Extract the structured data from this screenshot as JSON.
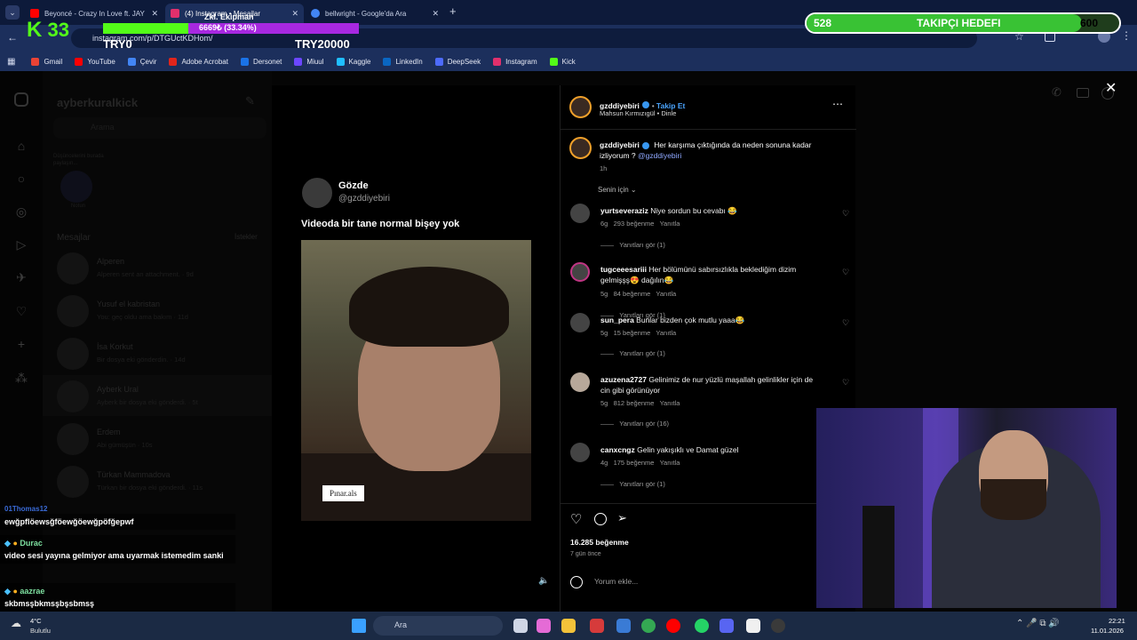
{
  "browser": {
    "tabs": [
      {
        "label": "Beyoncé - Crazy In Love ft. JAY",
        "color": "#ff0000"
      },
      {
        "label": "(4) Instagram • Mesajlar",
        "color": "#e1306c"
      },
      {
        "label": "bellwright - Google'da Ara",
        "color": "#4285f4"
      }
    ],
    "new_tab": "+",
    "url": "instagram.com/p/DTGUctKDHom/",
    "bookmarks": [
      {
        "label": "Gmail",
        "color": "#ea4335"
      },
      {
        "label": "YouTube",
        "color": "#ff0000"
      },
      {
        "label": "Çevir",
        "color": "#4285f4"
      },
      {
        "label": "Adobe Acrobat",
        "color": "#e1251b"
      },
      {
        "label": "Dersonet",
        "color": "#1a73e8"
      },
      {
        "label": "Miuul",
        "color": "#6c47ff"
      },
      {
        "label": "Kaggle",
        "color": "#20beff"
      },
      {
        "label": "LinkedIn",
        "color": "#0a66c2"
      },
      {
        "label": "DeepSeek",
        "color": "#4d6bfe"
      },
      {
        "label": "Instagram",
        "color": "#e1306c"
      },
      {
        "label": "Kick",
        "color": "#53fc18"
      }
    ]
  },
  "kick_overlay": {
    "logo": "33",
    "title": "Zkl. Ekipman",
    "progress_text": "6669₺ (33.34%)",
    "progress_fraction": 0.3334,
    "left_label": "TRY0",
    "right_label": "TRY20000"
  },
  "follower_goal": {
    "current": "528",
    "label": "TAKIPÇI HEDEFI",
    "target": "600",
    "fraction": 0.88
  },
  "sidebar": {
    "account": "ayberkuralkick",
    "search_placeholder": "Arama",
    "note_text": "Düşüncelerini burada paylaşın...",
    "note_name": "Notun",
    "section_title": "Mesajlar",
    "section_link": "İstekler",
    "conversations": [
      {
        "name": "Alperen",
        "snippet": "Alperen sent an attachment. · 9d"
      },
      {
        "name": "Yusuf el kabristan",
        "snippet": "You: geç oldu ama bakım · 11d"
      },
      {
        "name": "İsa Korkut",
        "snippet": "Bir dosya eki gönderdin. · 14d"
      },
      {
        "name": "Ayberk Ural",
        "snippet": "Ayberk bir dosya eki gönderdi. · 5t"
      },
      {
        "name": "Erdem",
        "snippet": "Abi gümüşün · 10s"
      },
      {
        "name": "Türkan Mammadova",
        "snippet": "Türkan bir dosya eki gönderdi. · 11s"
      }
    ]
  },
  "post": {
    "tweet_name": "Gözde",
    "tweet_handle": "@gzddiyebiri",
    "tweet_text": "Videoda bir tane normal bişey yok",
    "watermark": "Pınar.als",
    "author": "gzddiyebiri",
    "follow": "Takip Et",
    "music": "Mahsun Kırmızıgül • Dinle",
    "caption_user": "gzddiyebiri",
    "caption": "Her karşıma çıktığında da neden sonuna kadar izliyorum ?",
    "caption_mention": "@gzddiyebiri",
    "caption_time": "1h",
    "sort": "Senin için",
    "comments": [
      {
        "user": "yurtseveraziz",
        "text": "Niye sordun bu cevabı 😂",
        "meta": "6g   293 beğenme   Yanıtla",
        "replies": "Yanıtları gör (1)"
      },
      {
        "user": "tugceeesariii",
        "text": "Her bölümünü sabırsızlıkla beklediğim dizim gelmişşş😍 dağılın😂",
        "meta": "5g   84 beğenme   Yanıtla",
        "replies": "Yanıtları gör (1)"
      },
      {
        "user": "sun_pera",
        "text": "Bunlar bizden çok mutlu yaaa😂",
        "meta": "5g   15 beğenme   Yanıtla",
        "replies": "Yanıtları gör (1)"
      },
      {
        "user": "azuzena2727",
        "text": "Gelinimiz de nur yüzlü maşallah gelinlikler için de cin gibi görünüyor",
        "meta": "5g   812 beğenme   Yanıtla",
        "replies": "Yanıtları gör (16)"
      },
      {
        "user": "canxcngz",
        "text": "Gelin yakışıklı ve Damat güzel",
        "meta": "4g   175 beğenme   Yanıtla",
        "replies": "Yanıtları gör (1)"
      }
    ],
    "likes": "16.285 beğenme",
    "posted": "7 gün önce",
    "comment_placeholder": "Yorum ekle..."
  },
  "chat": [
    {
      "user": "01Thomas12",
      "badge": "",
      "message": "ewğpflöewsğföewğöewğpöfğepwf"
    },
    {
      "user": "Durac",
      "badge": "",
      "message": "video sesi yayına gelmiyor ama uyarmak istemedim sanki"
    },
    {
      "user": "aazrae",
      "badge": "",
      "message": "skbmsşbkmsşbşsbmsş"
    }
  ],
  "taskbar": {
    "weather_temp": "4°C",
    "weather_desc": "Bulutlu",
    "search": "Ara",
    "time": "22:21",
    "date": "11.01.2026"
  }
}
